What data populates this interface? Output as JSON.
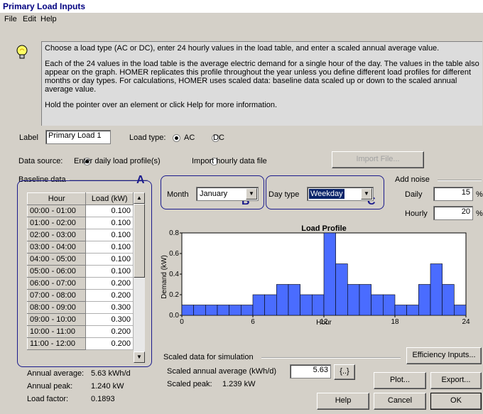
{
  "window": {
    "title": "Primary Load Inputs"
  },
  "menu": [
    "File",
    "Edit",
    "Help"
  ],
  "info": {
    "p1": "Choose a load type (AC or DC), enter 24 hourly values in the load table, and enter a scaled annual average value.",
    "p2": "Each of the 24 values in the load table is the average electric demand for a single hour of the day. The values in the table also appear on the graph. HOMER replicates this profile throughout the year unless you define different load profiles for different months or day types. For calculations, HOMER uses scaled data: baseline data scaled up or down to the scaled annual average value.",
    "p3": "Hold the pointer over an element or click Help for more information."
  },
  "label": {
    "caption": "Label",
    "value": "Primary Load 1"
  },
  "load_type": {
    "caption": "Load type:",
    "ac": "AC",
    "dc": "DC",
    "selected": "AC"
  },
  "data_source": {
    "caption": "Data source:",
    "opt1": "Enter daily load profile(s)",
    "opt2": "Import hourly data file",
    "selected": "opt1",
    "import_button": "Import File..."
  },
  "baseline": {
    "caption": "Baseline data",
    "col_hour": "Hour",
    "col_load": "Load (kW)",
    "rows": [
      {
        "hour": "00:00 - 01:00",
        "load": "0.100"
      },
      {
        "hour": "01:00 - 02:00",
        "load": "0.100"
      },
      {
        "hour": "02:00 - 03:00",
        "load": "0.100"
      },
      {
        "hour": "03:00 - 04:00",
        "load": "0.100"
      },
      {
        "hour": "04:00 - 05:00",
        "load": "0.100"
      },
      {
        "hour": "05:00 - 06:00",
        "load": "0.100"
      },
      {
        "hour": "06:00 - 07:00",
        "load": "0.200"
      },
      {
        "hour": "07:00 - 08:00",
        "load": "0.200"
      },
      {
        "hour": "08:00 - 09:00",
        "load": "0.300"
      },
      {
        "hour": "09:00 - 10:00",
        "load": "0.300"
      },
      {
        "hour": "10:00 - 11:00",
        "load": "0.200"
      },
      {
        "hour": "11:00 - 12:00",
        "load": "0.200"
      }
    ]
  },
  "month": {
    "caption": "Month",
    "value": "January"
  },
  "day_type": {
    "caption": "Day type",
    "value": "Weekday"
  },
  "annotations": {
    "a": "A",
    "b": "B",
    "c": "C"
  },
  "noise": {
    "caption": "Add noise",
    "daily_label": "Daily",
    "daily_value": "15",
    "hourly_label": "Hourly",
    "hourly_value": "20",
    "unit": "%"
  },
  "chart_data": {
    "type": "bar",
    "title": "Load Profile",
    "xlabel": "Hour",
    "ylabel": "Demand (kW)",
    "x": [
      0,
      1,
      2,
      3,
      4,
      5,
      6,
      7,
      8,
      9,
      10,
      11,
      12,
      13,
      14,
      15,
      16,
      17,
      18,
      19,
      20,
      21,
      22,
      23
    ],
    "values": [
      0.1,
      0.1,
      0.1,
      0.1,
      0.1,
      0.1,
      0.2,
      0.2,
      0.3,
      0.3,
      0.2,
      0.2,
      0.8,
      0.5,
      0.3,
      0.3,
      0.2,
      0.2,
      0.1,
      0.1,
      0.3,
      0.5,
      0.3,
      0.1
    ],
    "xlim": [
      0,
      24
    ],
    "ylim": [
      0,
      0.8
    ],
    "xticks": [
      "0",
      "6",
      "12",
      "18",
      "24"
    ],
    "yticks": [
      "0.0",
      "0.2",
      "0.4",
      "0.6",
      "0.8"
    ],
    "grid": false,
    "bar_color": "#4a6cff"
  },
  "stats": {
    "avg_label": "Annual average:",
    "avg_value": "5.63 kWh/d",
    "peak_label": "Annual peak:",
    "peak_value": "1.240 kW",
    "lf_label": "Load factor:",
    "lf_value": "0.1893"
  },
  "scaled": {
    "caption": "Scaled data for simulation",
    "avg_label": "Scaled annual average (kWh/d)",
    "avg_value": "5.63",
    "sens_button": "{..}",
    "peak_label": "Scaled peak:",
    "peak_value": "1.239 kW"
  },
  "buttons": {
    "efficiency": "Efficiency Inputs...",
    "plot": "Plot...",
    "export": "Export...",
    "help": "Help",
    "cancel": "Cancel",
    "ok": "OK"
  }
}
